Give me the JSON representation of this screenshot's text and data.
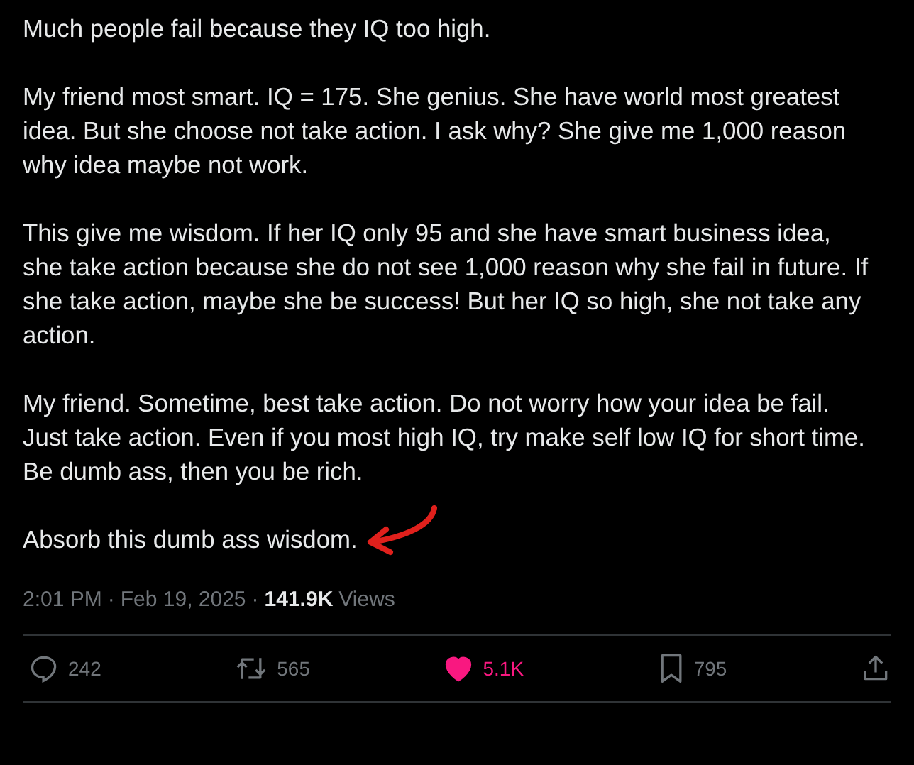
{
  "post": {
    "paragraphs": [
      "Much people fail because they IQ too high.",
      "My friend most smart. IQ = 175. She genius. She have world most greatest idea. But she choose not take action. I ask why? She give me 1,000 reason why idea maybe not work.",
      "This give me wisdom. If her IQ only 95 and she have smart business idea, she take action because she do not see 1,000 reason why she fail in future. If she take action, maybe she be success! But her IQ so high, she not take any action.",
      "My friend. Sometime, best take action. Do not worry how your idea be fail. Just take action. Even if you most high IQ, try make self low IQ for short time. Be dumb ass, then you be rich.",
      "Absorb this dumb ass wisdom."
    ],
    "time": "2:01 PM",
    "separator": "·",
    "date": "Feb 19, 2025",
    "views_count": "141.9K",
    "views_label": "Views"
  },
  "actions": [
    {
      "kind": "reply",
      "count": "242"
    },
    {
      "kind": "repost",
      "count": "565",
      "selected": false
    },
    {
      "kind": "like",
      "count": "5.1K",
      "selected": true
    },
    {
      "kind": "bookmark",
      "count": "795",
      "selected": false
    },
    {
      "kind": "share"
    }
  ]
}
